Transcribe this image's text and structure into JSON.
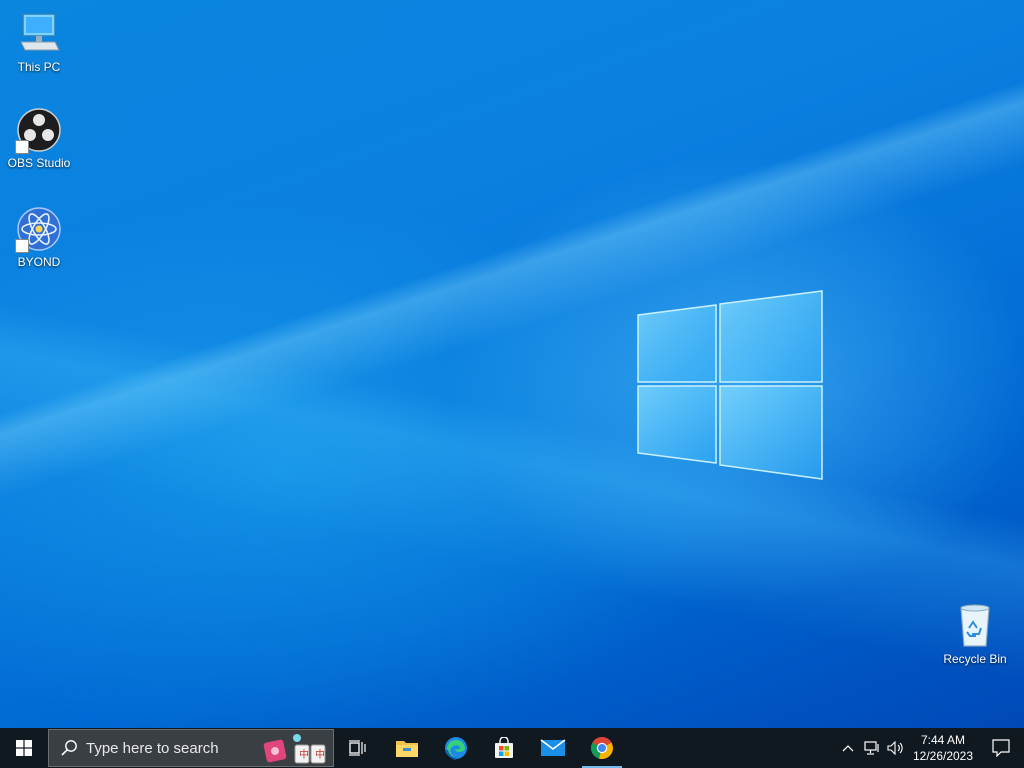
{
  "desktop": {
    "icons": [
      {
        "label": "This PC",
        "icon": "computer-icon"
      },
      {
        "label": "OBS Studio",
        "icon": "obs-icon"
      },
      {
        "label": "BYOND",
        "icon": "byond-icon"
      },
      {
        "label": "Recycle Bin",
        "icon": "recycle-bin-icon"
      }
    ]
  },
  "taskbar": {
    "search": {
      "placeholder": "Type here to search"
    },
    "apps": [
      {
        "name": "Task View",
        "icon": "task-view-icon"
      },
      {
        "name": "File Explorer",
        "icon": "folder-icon"
      },
      {
        "name": "Microsoft Edge",
        "icon": "edge-icon"
      },
      {
        "name": "Microsoft Store",
        "icon": "store-icon"
      },
      {
        "name": "Mail",
        "icon": "mail-icon"
      },
      {
        "name": "Google Chrome",
        "icon": "chrome-icon",
        "active": true
      }
    ],
    "tray": {
      "time": "7:44 AM",
      "date": "12/26/2023"
    }
  },
  "colors": {
    "desktop_blue": "#0078d7",
    "taskbar": "#101820",
    "active_indicator": "#76b9ed"
  }
}
